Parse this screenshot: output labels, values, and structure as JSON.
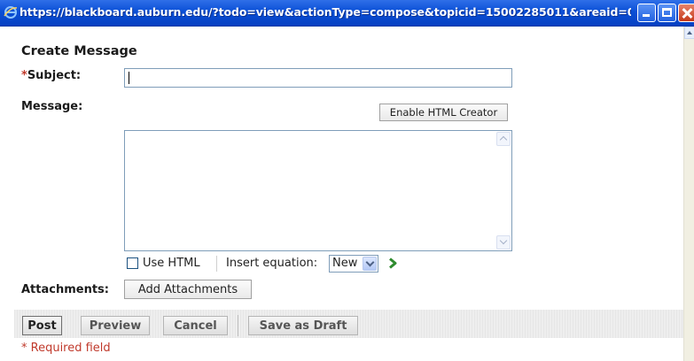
{
  "window": {
    "title": "https://blackboard.auburn.edu/?todo=view&actionType=compose&topicid=15002285011&areaid=0...",
    "icons": {
      "browser": "ie-icon",
      "minimize": "minimize-icon",
      "maximize": "maximize-icon",
      "close": "close-icon"
    }
  },
  "form": {
    "heading": "Create Message",
    "subject_star": "*",
    "subject_label": "Subject:",
    "subject_value": "",
    "message_label": "Message:",
    "enable_html_label": "Enable HTML Creator",
    "message_value": "",
    "use_html_label": "Use HTML",
    "use_html_checked": false,
    "insert_equation_label": "Insert equation:",
    "insert_equation_value": "New",
    "attachments_label": "Attachments:",
    "add_attachments_label": "Add Attachments"
  },
  "actions": {
    "post": "Post",
    "preview": "Preview",
    "cancel": "Cancel",
    "save_draft": "Save as Draft"
  },
  "footer": {
    "required_note": "* Required field"
  },
  "colors": {
    "titlebar": "#0a4fd6",
    "required": "#c0392b",
    "input_border": "#7f9db9"
  }
}
